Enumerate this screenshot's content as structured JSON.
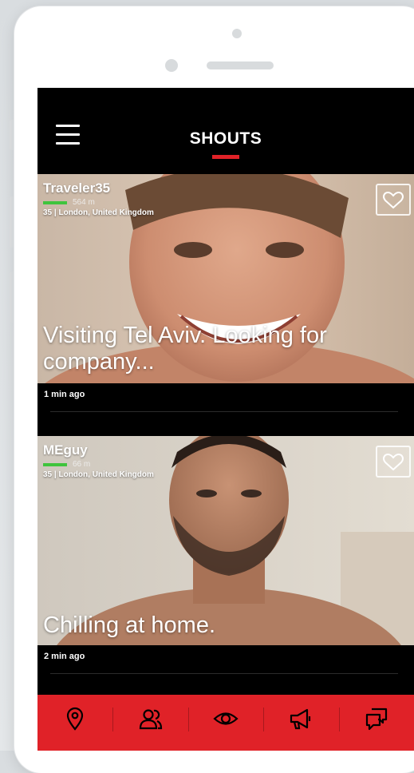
{
  "header": {
    "title": "SHOUTS"
  },
  "shouts": [
    {
      "username": "Traveler35",
      "distance": "564 m",
      "age": "35",
      "location": "London, United Kingdom",
      "message_line1": "Visiting Tel Aviv. Looking for",
      "message_line2": "company...",
      "time": "1 min ago"
    },
    {
      "username": "MEguy",
      "distance": "66 m",
      "age": "35",
      "location": "London, United Kingdom",
      "message_line1": "Chilling at home.",
      "time": "2 min ago"
    }
  ],
  "tabbar": {
    "icons": [
      "location-pin-icon",
      "people-icon",
      "eye-icon",
      "megaphone-icon",
      "chat-bubbles-icon"
    ]
  },
  "colors": {
    "accent": "#e02228",
    "online": "#3fc43d",
    "background": "#000000"
  }
}
